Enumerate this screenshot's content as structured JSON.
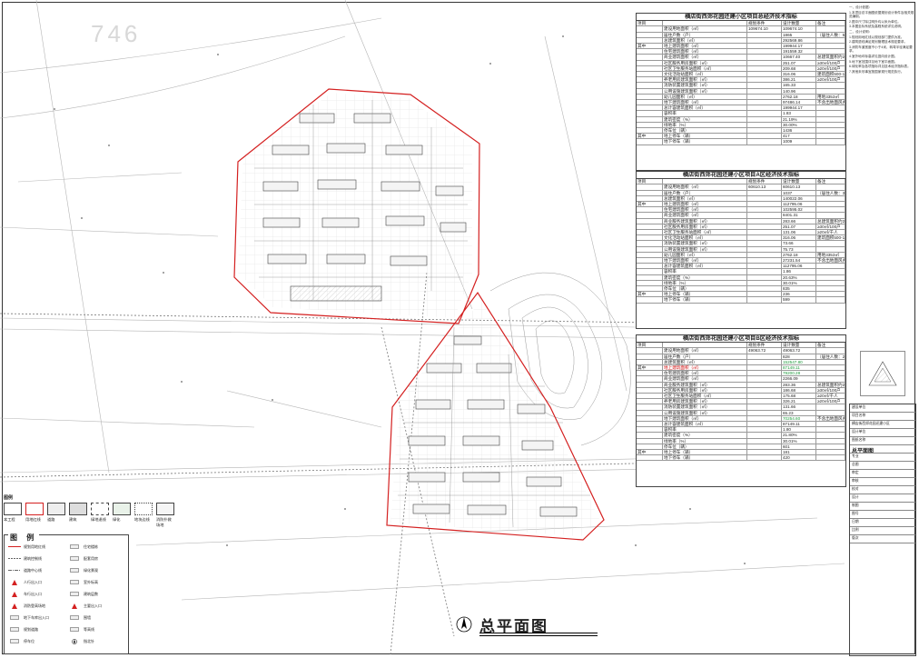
{
  "drawing_title": "总平面图",
  "map_label": "746",
  "tables": [
    {
      "title": "横店街西郊花园还建小区项目总经济技术指标",
      "header": [
        "项目",
        "",
        "规划条件",
        "设计数量",
        "备注"
      ],
      "rows": [
        [
          "",
          "建设用地面积（㎡）",
          "109674.10",
          "109674.10",
          ""
        ],
        [
          "",
          "居住户数（户）",
          "",
          "1865",
          "（居住人数：5968）"
        ],
        [
          "",
          "总建筑面积（㎡）",
          "",
          "292569.86",
          ""
        ],
        [
          "其中",
          "地上建筑面积（㎡）",
          "",
          "199944.17",
          ""
        ],
        [
          "",
          "住宅建筑面积（㎡）",
          "",
          "191559.32",
          ""
        ],
        [
          "",
          "商业建筑面积（㎡）",
          "",
          "10667.40",
          "总建筑面积约2%，≥500㎡"
        ],
        [
          "",
          "社区服务用房面积（㎡）",
          "",
          "251.07",
          "≥30㎡/100户"
        ],
        [
          "",
          "社区卫生服务站面积（㎡）",
          "",
          "209.68",
          "≥20㎡/100户"
        ],
        [
          "",
          "文化活动站面积（㎡）",
          "",
          "316.06",
          "建筑面积500-1000平方米/处"
        ],
        [
          "",
          "养老用房建筑面积（㎡）",
          "",
          "386.21",
          "≥20㎡/100户"
        ],
        [
          "",
          "消防装置建筑面积（㎡）",
          "",
          "165.33",
          ""
        ],
        [
          "",
          "公用设施建筑面积（㎡）",
          "",
          "140.96",
          ""
        ],
        [
          "",
          "幼儿园面积（㎡）",
          "",
          "2762.18",
          "用地3353㎡"
        ],
        [
          "",
          "地下建筑面积（㎡）",
          "",
          "97486.14",
          "不含出地面风井及疏散楼"
        ],
        [
          "",
          "总计容建筑面积（㎡）",
          "",
          "199944.17",
          ""
        ],
        [
          "",
          "容积率",
          "",
          "1.83",
          ""
        ],
        [
          "",
          "建筑密度（%）",
          "",
          "21.19%",
          ""
        ],
        [
          "",
          "绿地率（%）",
          "",
          "30.00%",
          ""
        ],
        [
          "",
          "停车位（辆）",
          "",
          "1436",
          ""
        ],
        [
          "其中",
          "地上停车（辆）",
          "",
          "417",
          ""
        ],
        [
          "",
          "地下停车（辆）",
          "",
          "1009",
          ""
        ]
      ]
    },
    {
      "title": "横店街西郊花园还建小区项目A区经济技术指标",
      "header": [
        "项目",
        "",
        "规划条件",
        "设计数量",
        "备注"
      ],
      "rows": [
        [
          "",
          "建设用地面积（㎡）",
          "60610.13",
          "60610.13",
          ""
        ],
        [
          "",
          "居住户数（户）",
          "",
          "1037",
          "（居住人数：3319）"
        ],
        [
          "",
          "总建筑面积（㎡）",
          "",
          "140022.06",
          ""
        ],
        [
          "其中",
          "地上建筑面积（㎡）",
          "",
          "112795.06",
          ""
        ],
        [
          "",
          "住宅建筑面积（㎡）",
          "",
          "102595.02",
          ""
        ],
        [
          "",
          "商业建筑面积（㎡）",
          "",
          "8401.31",
          ""
        ],
        [
          "",
          "商业服务建筑面积（㎡）",
          "",
          "283.66",
          "总建筑面积约2%，≥500㎡"
        ],
        [
          "",
          "社区服务用房面积（㎡）",
          "",
          "251.07",
          "≥30㎡/100户"
        ],
        [
          "",
          "社区卫生服务站面积（㎡）",
          "",
          "131.06",
          "≥20㎡/千人"
        ],
        [
          "",
          "文化活动站面积（㎡）",
          "",
          "316.06",
          "建筑面积500-1000平方米/处"
        ],
        [
          "",
          "消防装置建筑面积（㎡）",
          "",
          "73.66",
          ""
        ],
        [
          "",
          "公用设施建筑面积（㎡）",
          "",
          "75.73",
          ""
        ],
        [
          "",
          "幼儿园面积（㎡）",
          "",
          "2762.18",
          "用地3353㎡"
        ],
        [
          "",
          "地下建筑面积（㎡）",
          "",
          "27231.54",
          "不含出地面风井及疏散楼"
        ],
        [
          "",
          "总计容建筑面积（㎡）",
          "",
          "112795.06",
          ""
        ],
        [
          "",
          "容积率",
          "",
          "1.86",
          ""
        ],
        [
          "",
          "建筑密度（%）",
          "",
          "20.63%",
          ""
        ],
        [
          "",
          "绿地率（%）",
          "",
          "30.01%",
          ""
        ],
        [
          "",
          "停车位（辆）",
          "",
          "835",
          ""
        ],
        [
          "其中",
          "地上停车（辆）",
          "",
          "236",
          ""
        ],
        [
          "",
          "地下停车（辆）",
          "",
          "599",
          ""
        ]
      ]
    },
    {
      "title": "横店街西郊花园还建小区项目B区经济技术指标",
      "header": [
        "项目",
        "",
        "规划条件",
        "设计数量",
        "备注"
      ],
      "rows": [
        [
          "",
          "建设用地面积（㎡）",
          "49063.72",
          "49063.72",
          ""
        ],
        [
          "",
          "居住户数（户）",
          "",
          "828",
          "（居住人数：2799）"
        ],
        [
          "",
          "总建筑面积（㎡）",
          "",
          "152547.80",
          ""
        ],
        [
          "其中",
          "地上建筑面积（㎡）",
          "",
          "87149.11",
          ""
        ],
        [
          "",
          "住宅建筑面积（㎡）",
          "",
          "79200.28",
          ""
        ],
        [
          "",
          "商业建筑面积（㎡）",
          "",
          "2266.09",
          ""
        ],
        [
          "",
          "商业服务建筑面积（㎡）",
          "",
          "283.36",
          "总建筑面积约2%，≥500㎡"
        ],
        [
          "",
          "社区服务用房面积（㎡）",
          "",
          "186.68",
          "≥30㎡/100户"
        ],
        [
          "",
          "社区卫生服务站面积（㎡）",
          "",
          "175.68",
          "≥20㎡/千人"
        ],
        [
          "",
          "养老用房建筑面积（㎡）",
          "",
          "326.21",
          "≥20㎡/100户"
        ],
        [
          "",
          "消防装置建筑面积（㎡）",
          "",
          "131.66",
          ""
        ],
        [
          "",
          "公用设施建筑面积（㎡）",
          "",
          "65.23",
          ""
        ],
        [
          "",
          "地下建筑面积（㎡）",
          "",
          "70254.60",
          "不含出地面风井及疏散楼"
        ],
        [
          "",
          "总计容建筑面积（㎡）",
          "",
          "87149.11",
          ""
        ],
        [
          "",
          "容积率",
          "",
          "1.80",
          ""
        ],
        [
          "",
          "建筑密度（%）",
          "",
          "21.80%",
          ""
        ],
        [
          "",
          "绿地率（%）",
          "",
          "30.01%",
          ""
        ],
        [
          "",
          "停车位（辆）",
          "",
          "601",
          ""
        ],
        [
          "其中",
          "地上停车（辆）",
          "",
          "181",
          ""
        ],
        [
          "",
          "地下停车（辆）",
          "",
          "420",
          ""
        ]
      ]
    }
  ],
  "notes": [
    "一、设计依据：",
    "1.本项目总平面图依据规划设计条件及相关规范编制。",
    "2.图中尺寸除注明外均以米为单位。",
    "3.本图坐标系统及高程系统详见说明。",
    "二、设计说明：",
    "1.规划用地红线以规划部门提供为准。",
    "2.建筑退线满足规划管理技术规定要求。",
    "3.消防车道宽度不小于4米，转弯半径满足要求。",
    "4.室外地坪标高详见竖向设计图。",
    "5.地下室范围详见地下室平面图。",
    "6.绿化率及各项指标详见技术经济指标表。",
    "7.其他未尽事宜按国家现行规范执行。"
  ],
  "legend_top": {
    "title": "图例",
    "items": [
      "本工程",
      "用地红线",
      "道路",
      "建筑",
      "绿地退线",
      "绿化",
      "地块边线",
      "消防扑救场地"
    ]
  },
  "legend": {
    "title": "图 例",
    "items": [
      "规划用地红线",
      "建筑控制线",
      "道路中心线",
      "人行出入口",
      "车行出入口",
      "消防登高场地",
      "地下车库出入口",
      "规划道路",
      "停车位",
      "住宅楼栋",
      "配套用房",
      "绿化景观",
      "室外标高",
      "建筑层数",
      "主要出入口",
      "围墙",
      "等高线",
      "指北针"
    ]
  },
  "title_block": {
    "rows": [
      "建设单位",
      "项目名称",
      "横店街西郊花园还建小区",
      "设计单位",
      "图纸名称",
      "总平面图",
      "专业",
      "总图",
      "审定",
      "审核",
      "校对",
      "设计",
      "制图",
      "图号",
      "日期",
      "比例",
      "版次"
    ]
  },
  "colors": {
    "red_line": "#d42020",
    "green_text": "#1a9a3a",
    "line": "#555555",
    "accent_red": "#cc0000"
  }
}
